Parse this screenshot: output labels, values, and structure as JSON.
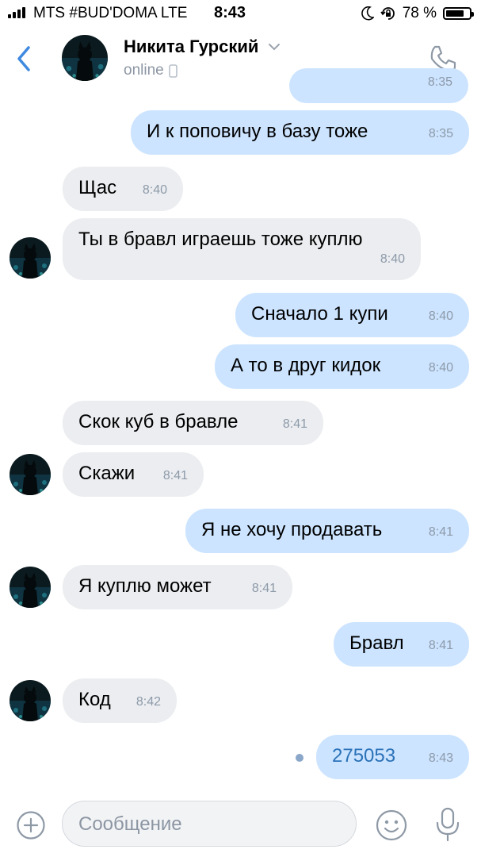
{
  "status_bar": {
    "carrier": "MTS #BUD'DOMA  LTE",
    "time": "8:43",
    "battery_percent": "78 %",
    "battery_level": 0.78
  },
  "header": {
    "contact_name": "Никита Гурский",
    "status": "online"
  },
  "messages": [
    {
      "dir": "out",
      "text": "",
      "time": "8:35",
      "partial": true
    },
    {
      "dir": "out",
      "text": "И к поповичу в базу тоже",
      "time": "8:35"
    },
    {
      "dir": "in",
      "text": "Щас",
      "time": "8:40"
    },
    {
      "dir": "in",
      "text": "Ты в бравл играешь тоже куплю",
      "time": "8:40"
    },
    {
      "dir": "out",
      "text": "Сначало 1 купи",
      "time": "8:40"
    },
    {
      "dir": "out",
      "text": "А то в друг кидок",
      "time": "8:40"
    },
    {
      "dir": "in",
      "text": "Скок куб в бравле",
      "time": "8:41"
    },
    {
      "dir": "in",
      "text": "Скажи",
      "time": "8:41"
    },
    {
      "dir": "out",
      "text": "Я не хочу продавать",
      "time": "8:41"
    },
    {
      "dir": "in",
      "text": "Я куплю может",
      "time": "8:41"
    },
    {
      "dir": "out",
      "text": "Бравл",
      "time": "8:41"
    },
    {
      "dir": "in",
      "text": "Код",
      "time": "8:42"
    },
    {
      "dir": "out",
      "text": "275053",
      "time": "8:43",
      "unread": true
    }
  ],
  "composer": {
    "placeholder": "Сообщение"
  },
  "icons": {
    "back": "chevron-left-icon",
    "call": "phone-icon",
    "device": "mobile-device-icon",
    "attach": "plus-circle-icon",
    "emoji": "smile-icon",
    "voice": "microphone-icon"
  },
  "colors": {
    "incoming_bubble": "#ebedf0",
    "outgoing_bubble": "#cce4ff",
    "link_text": "#2b72b8",
    "muted": "#8d9aa9"
  }
}
